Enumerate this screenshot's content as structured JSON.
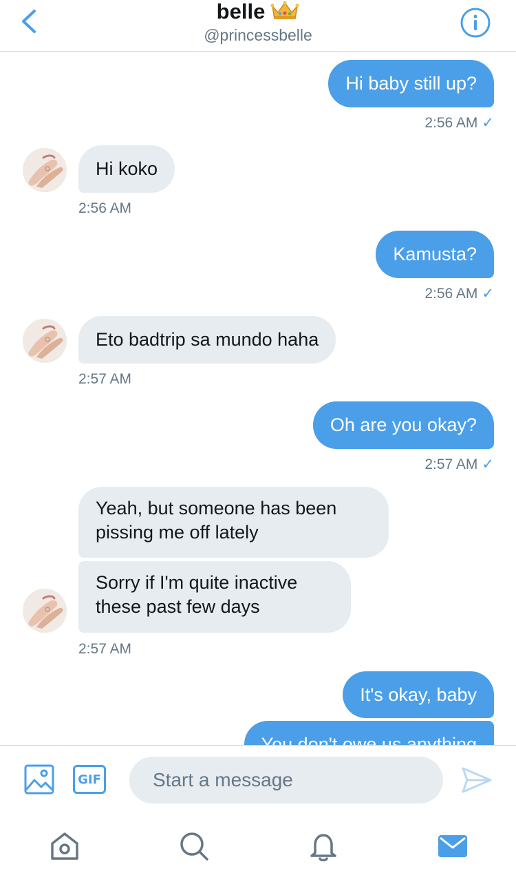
{
  "header": {
    "name": "belle",
    "emoji_icon": "crown-emoji",
    "handle": "@princessbelle",
    "back_icon": "chevron-left-icon",
    "info_icon": "info-icon"
  },
  "messages": [
    {
      "dir": "out",
      "text": "Hi baby still up?",
      "time": "2:56 AM",
      "check": "✓"
    },
    {
      "dir": "in",
      "text": "Hi koko",
      "time": "2:56 AM"
    },
    {
      "dir": "out",
      "text": "Kamusta?",
      "time": "2:56 AM",
      "check": "✓"
    },
    {
      "dir": "in",
      "text": "Eto badtrip sa mundo haha",
      "time": "2:57 AM"
    },
    {
      "dir": "out",
      "text": "Oh are you okay?",
      "time": "2:57 AM",
      "check": "✓"
    },
    {
      "dir": "in",
      "text": "Yeah, but someone has been pissing me off lately"
    },
    {
      "dir": "in",
      "text": "Sorry if I'm quite inactive these past few days",
      "time": "2:57 AM"
    },
    {
      "dir": "out",
      "text": "It's okay, baby"
    },
    {
      "dir": "out",
      "text": "You don't owe us anything"
    }
  ],
  "composer": {
    "gif_label": "GIF",
    "placeholder": "Start a message",
    "image_icon": "image-icon",
    "send_icon": "send-icon"
  },
  "tabbar": {
    "tabs": [
      "home-icon",
      "search-icon",
      "bell-icon",
      "mail-icon"
    ],
    "active": "mail-icon"
  },
  "colors": {
    "accent": "#4a9fe8",
    "incoming_bubble": "#e6ecf0",
    "secondary_text": "#657786"
  }
}
